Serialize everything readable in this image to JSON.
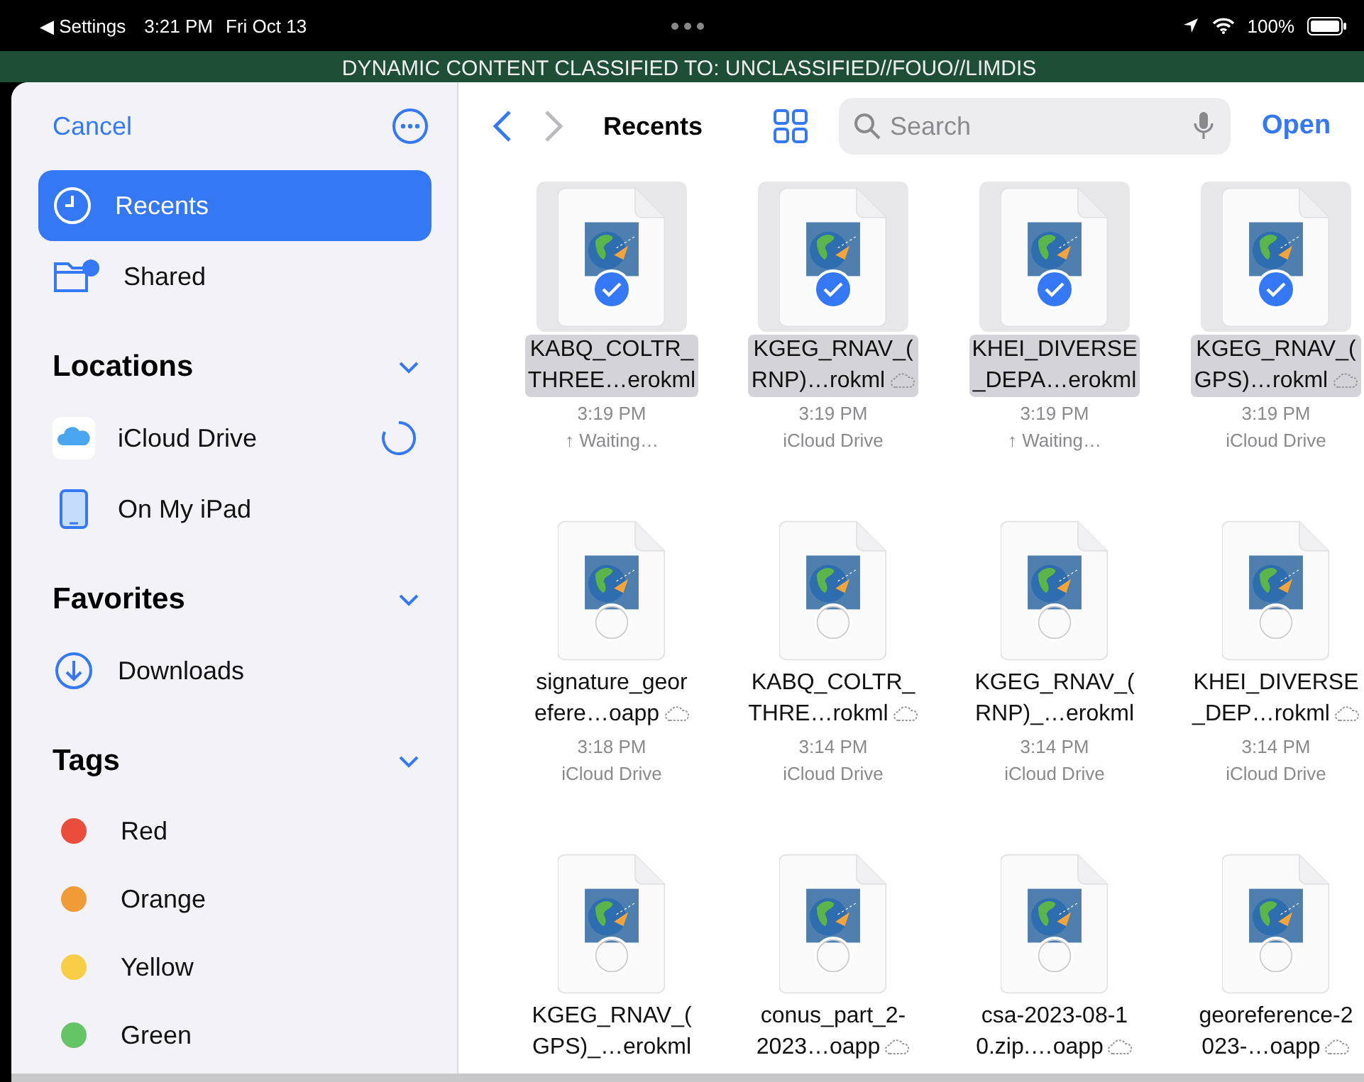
{
  "status_bar": {
    "back": "◀ Settings",
    "time": "3:21 PM",
    "date": "Fri Oct 13",
    "battery": "100%"
  },
  "banner": "DYNAMIC CONTENT CLASSIFIED TO: UNCLASSIFIED//FOUO//LIMDIS",
  "sidebar": {
    "cancel": "Cancel",
    "top_items": [
      {
        "label": "Recents",
        "kind": "clock",
        "selected": true
      },
      {
        "label": "Shared",
        "kind": "shared",
        "selected": false
      }
    ],
    "sections": [
      {
        "title": "Locations",
        "expanded": true,
        "items": [
          {
            "label": "iCloud Drive",
            "kind": "icloud",
            "syncing": true
          },
          {
            "label": "On My iPad",
            "kind": "ipad",
            "syncing": false
          }
        ]
      },
      {
        "title": "Favorites",
        "expanded": true,
        "items": [
          {
            "label": "Downloads",
            "kind": "download",
            "syncing": false
          }
        ]
      }
    ],
    "tags_title": "Tags",
    "tags": [
      {
        "label": "Red",
        "color": "#eb4d3d"
      },
      {
        "label": "Orange",
        "color": "#f19a38"
      },
      {
        "label": "Yellow",
        "color": "#f7ce46"
      },
      {
        "label": "Green",
        "color": "#65c466"
      }
    ]
  },
  "toolbar": {
    "title": "Recents",
    "search": {
      "placeholder": "Search"
    },
    "open": "Open"
  },
  "files": [
    {
      "name_lines": [
        "KABQ_COLTR_",
        "THREE…erokml"
      ],
      "cloud": false,
      "selected": true,
      "time": "3:19 PM",
      "location": "↑ Waiting…"
    },
    {
      "name_lines": [
        "KGEG_RNAV_(",
        "RNP)…rokml"
      ],
      "cloud": true,
      "selected": true,
      "time": "3:19 PM",
      "location": "iCloud Drive"
    },
    {
      "name_lines": [
        "KHEI_DIVERSE",
        "_DEPA…erokml"
      ],
      "cloud": false,
      "selected": true,
      "time": "3:19 PM",
      "location": "↑ Waiting…"
    },
    {
      "name_lines": [
        "KGEG_RNAV_(",
        "GPS)…rokml"
      ],
      "cloud": true,
      "selected": true,
      "time": "3:19 PM",
      "location": "iCloud Drive"
    },
    {
      "name_lines": [
        "signature_geor",
        "efere…oapp"
      ],
      "cloud": true,
      "selected": false,
      "time": "3:18 PM",
      "location": "iCloud Drive"
    },
    {
      "name_lines": [
        "KABQ_COLTR_",
        "THRE…rokml"
      ],
      "cloud": true,
      "selected": false,
      "time": "3:14 PM",
      "location": "iCloud Drive"
    },
    {
      "name_lines": [
        "KGEG_RNAV_(",
        "RNP)_…erokml"
      ],
      "cloud": false,
      "selected": false,
      "time": "3:14 PM",
      "location": "iCloud Drive"
    },
    {
      "name_lines": [
        "KHEI_DIVERSE",
        "_DEP…rokml"
      ],
      "cloud": true,
      "selected": false,
      "time": "3:14 PM",
      "location": "iCloud Drive"
    },
    {
      "name_lines": [
        "KGEG_RNAV_(",
        "GPS)_…erokml"
      ],
      "cloud": false,
      "selected": false
    },
    {
      "name_lines": [
        "conus_part_2-",
        "2023…oapp"
      ],
      "cloud": true,
      "selected": false
    },
    {
      "name_lines": [
        "csa-2023-08-1",
        "0.zip.…oapp"
      ],
      "cloud": true,
      "selected": false
    },
    {
      "name_lines": [
        "georeference-2",
        "023-…oapp"
      ],
      "cloud": true,
      "selected": false
    }
  ]
}
